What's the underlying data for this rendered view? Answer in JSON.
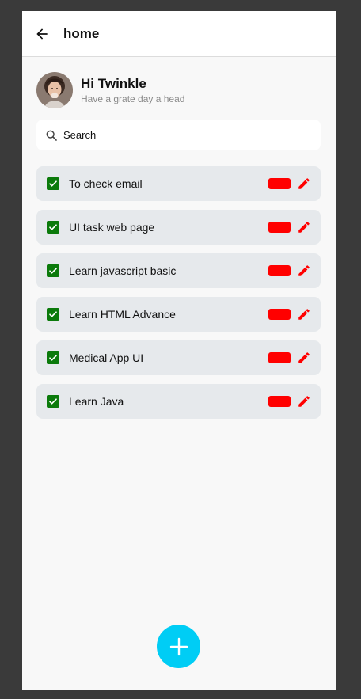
{
  "appbar": {
    "title": "home",
    "back_icon": "arrow-left-icon"
  },
  "profile": {
    "name": "Hi Twinkle",
    "subtitle": "Have a grate day a head"
  },
  "search": {
    "placeholder": "Search",
    "value": "",
    "icon": "search-icon"
  },
  "todos": [
    {
      "label": "To check email",
      "done": true
    },
    {
      "label": "UI task web page",
      "done": true
    },
    {
      "label": "Learn javascript basic",
      "done": true
    },
    {
      "label": "Learn HTML Advance",
      "done": true
    },
    {
      "label": "Medical App UI",
      "done": true
    },
    {
      "label": "Learn Java",
      "done": true
    }
  ],
  "fab": {
    "icon": "plus-icon"
  },
  "colors": {
    "check": "#0b7a0b",
    "delete": "#ff0000",
    "edit": "#ff0000",
    "fab": "#00cdf5",
    "item_bg": "#e6e9ec"
  }
}
